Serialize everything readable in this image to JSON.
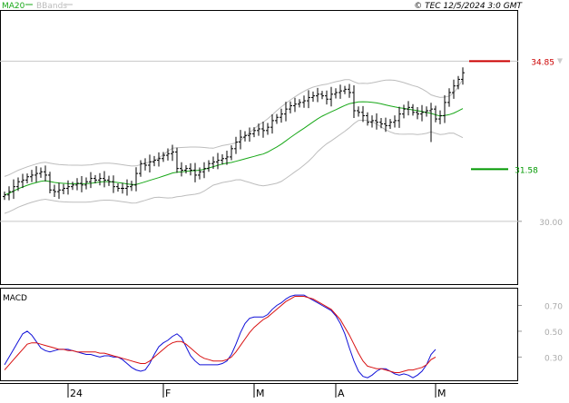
{
  "header": {
    "indicator_ma": "MA20",
    "indicator_bb": "BBands",
    "copyright": "© TEC 12/5/2024 3:0 GMT"
  },
  "colors": {
    "ma": "#18a818",
    "bands": "#bdbdbd",
    "price_bar": "#000000",
    "macd_line": "#1010d8",
    "signal_line": "#d81010",
    "resistance": "#cc0000",
    "support": "#009900",
    "grid": "#c8c8c8"
  },
  "chart_data": [
    {
      "type": "ohlc",
      "ylim": [
        28.1,
        36.4
      ],
      "yticks": [
        {
          "value": 30.0,
          "label": "30.00"
        }
      ],
      "x_ticks": [
        {
          "index": 14,
          "label": "24"
        },
        {
          "index": 35,
          "label": "F"
        },
        {
          "index": 55,
          "label": "M"
        },
        {
          "index": 73,
          "label": "A"
        },
        {
          "index": 95,
          "label": "M"
        }
      ],
      "hlines": [
        34.85,
        30.0
      ],
      "levels": [
        {
          "value": 34.85,
          "label": "34.85",
          "kind": "resistance"
        },
        {
          "value": 31.58,
          "label": "31.58",
          "kind": "support"
        }
      ],
      "close": [
        30.8,
        30.9,
        31.05,
        31.2,
        31.25,
        31.35,
        31.4,
        31.45,
        31.5,
        31.4,
        30.95,
        30.9,
        30.95,
        31.0,
        31.05,
        31.1,
        31.15,
        31.1,
        31.2,
        31.3,
        31.25,
        31.3,
        31.25,
        31.2,
        31.05,
        31.0,
        31.0,
        31.05,
        31.1,
        31.45,
        31.75,
        31.7,
        31.8,
        31.85,
        31.9,
        32.0,
        32.05,
        32.1,
        31.6,
        31.55,
        31.6,
        31.55,
        31.4,
        31.5,
        31.6,
        31.75,
        31.8,
        31.85,
        31.9,
        31.95,
        32.2,
        32.4,
        32.55,
        32.6,
        32.65,
        32.75,
        32.8,
        32.75,
        32.85,
        33.05,
        33.15,
        33.25,
        33.4,
        33.5,
        33.55,
        33.6,
        33.65,
        33.75,
        33.8,
        33.85,
        33.8,
        33.7,
        33.85,
        33.9,
        33.95,
        34.0,
        33.9,
        33.35,
        33.3,
        33.2,
        33.0,
        33.05,
        33.0,
        32.95,
        32.9,
        33.0,
        33.05,
        33.25,
        33.4,
        33.45,
        33.3,
        33.25,
        33.3,
        33.35,
        33.4,
        33.1,
        33.2,
        33.6,
        33.9,
        34.1,
        34.3,
        34.5
      ]
    },
    {
      "type": "line",
      "title": "MACD",
      "ylim": [
        0.12,
        0.83
      ],
      "yticks": [
        {
          "value": 0.7,
          "label": "0.70"
        },
        {
          "value": 0.5,
          "label": "0.50"
        },
        {
          "value": 0.3,
          "label": "0.30"
        }
      ],
      "series": [
        {
          "values": [
            0.24,
            0.3,
            0.36,
            0.42,
            0.48,
            0.5,
            0.47,
            0.42,
            0.37,
            0.35,
            0.34,
            0.35,
            0.36,
            0.36,
            0.36,
            0.35,
            0.34,
            0.33,
            0.32,
            0.32,
            0.31,
            0.3,
            0.31,
            0.31,
            0.3,
            0.3,
            0.28,
            0.25,
            0.22,
            0.2,
            0.19,
            0.2,
            0.25,
            0.32,
            0.38,
            0.41,
            0.43,
            0.46,
            0.48,
            0.45,
            0.38,
            0.31,
            0.27,
            0.24,
            0.24,
            0.24,
            0.24,
            0.24,
            0.25,
            0.27,
            0.32,
            0.4,
            0.49,
            0.56,
            0.6,
            0.61,
            0.61,
            0.61,
            0.63,
            0.67,
            0.7,
            0.72,
            0.75,
            0.77,
            0.78,
            0.78,
            0.78,
            0.76,
            0.74,
            0.72,
            0.7,
            0.68,
            0.66,
            0.62,
            0.56,
            0.48,
            0.37,
            0.27,
            0.19,
            0.15,
            0.14,
            0.16,
            0.19,
            0.21,
            0.21,
            0.19,
            0.17,
            0.16,
            0.17,
            0.16,
            0.14,
            0.16,
            0.19,
            0.24,
            0.32,
            0.36
          ]
        },
        {
          "values": [
            0.2,
            0.24,
            0.28,
            0.32,
            0.36,
            0.4,
            0.41,
            0.41,
            0.4,
            0.39,
            0.38,
            0.37,
            0.36,
            0.36,
            0.35,
            0.35,
            0.34,
            0.34,
            0.34,
            0.34,
            0.34,
            0.33,
            0.33,
            0.32,
            0.31,
            0.3,
            0.29,
            0.28,
            0.27,
            0.26,
            0.25,
            0.25,
            0.27,
            0.3,
            0.33,
            0.36,
            0.39,
            0.41,
            0.42,
            0.42,
            0.4,
            0.37,
            0.34,
            0.31,
            0.29,
            0.28,
            0.27,
            0.27,
            0.27,
            0.28,
            0.3,
            0.34,
            0.39,
            0.44,
            0.49,
            0.53,
            0.56,
            0.59,
            0.61,
            0.64,
            0.67,
            0.7,
            0.73,
            0.75,
            0.77,
            0.77,
            0.77,
            0.76,
            0.75,
            0.73,
            0.71,
            0.69,
            0.67,
            0.63,
            0.59,
            0.53,
            0.47,
            0.4,
            0.33,
            0.27,
            0.23,
            0.22,
            0.21,
            0.21,
            0.2,
            0.19,
            0.18,
            0.18,
            0.19,
            0.2,
            0.2,
            0.21,
            0.22,
            0.24,
            0.28,
            0.3
          ]
        }
      ]
    }
  ]
}
